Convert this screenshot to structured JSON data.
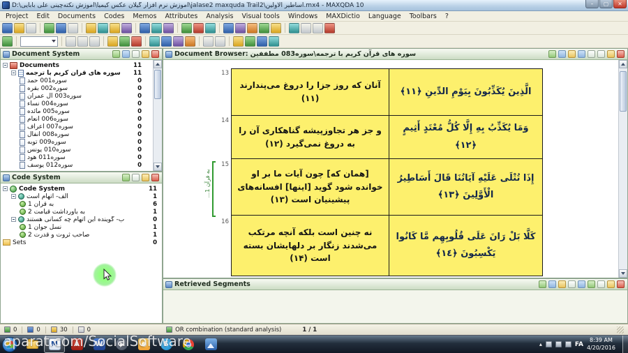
{
  "window": {
    "title": "D:\\آموزش نرم افزار گیلان عکس کیمیا\\آموزش نکته‌چینی علی بابایی\\jalase2 maxquda Trail2\\اساطیر الاولین.mx4 - MAXQDA 10",
    "controls": {
      "minimize": "–",
      "maximize": "▢",
      "close": "✕"
    }
  },
  "menu": {
    "items": [
      "Project",
      "Edit",
      "Documents",
      "Codes",
      "Memos",
      "Attributes",
      "Analysis",
      "Visual tools",
      "Windows",
      "MAXDictio",
      "Language",
      "Toolbars",
      "?"
    ]
  },
  "toolbar_main": {
    "icons": [
      "new-project",
      "open-project",
      "save-project",
      "new-document-group",
      "import-document",
      "print-document",
      "memo-manager",
      "overview-coded-segments",
      "overview-memos",
      "overview-links",
      "text-search",
      "lexical-search",
      "complex-search",
      "activate-documents",
      "reset-activation",
      "retrieved-segments",
      "maxmaps",
      "visual-tools",
      "document-portrait",
      "codeline",
      "word-cloud",
      "statistics",
      "undo",
      "redo",
      "help"
    ]
  },
  "toolbar_code": {
    "icons": [
      "edit-mode",
      "font-combo",
      "bold",
      "italic",
      "underline",
      "highlight-yellow",
      "highlight-green",
      "highlight-magenta",
      "code-selection",
      "code-new",
      "code-in-vivo",
      "emoticode",
      "zoom-out",
      "zoom-in",
      "bookmark",
      "coding-stripes",
      "search-in-document",
      "display-settings"
    ],
    "combo_value": ""
  },
  "document_system": {
    "title": "Document System",
    "header_icons": [
      "activate-icon",
      "new-group-icon",
      "float-icon",
      "maximize-icon",
      "close-icon"
    ],
    "root": {
      "label": "Documents",
      "count": "11"
    },
    "group": {
      "label": "سوره های قرآن کریم با ترجمه",
      "count": "11"
    },
    "items": [
      {
        "label": "سوره001 حمد",
        "count": "0"
      },
      {
        "label": "سوره002 بقره",
        "count": "0"
      },
      {
        "label": "سوره003 آل عمران",
        "count": "0"
      },
      {
        "label": "سوره004 نساء",
        "count": "0"
      },
      {
        "label": "سوره005 مائده",
        "count": "0"
      },
      {
        "label": "سوره006 انعام",
        "count": "0"
      },
      {
        "label": "سوره007 اعراف",
        "count": "0"
      },
      {
        "label": "سوره008 انفال",
        "count": "0"
      },
      {
        "label": "سوره009 توبه",
        "count": "0"
      },
      {
        "label": "سوره010 یونس",
        "count": "0"
      },
      {
        "label": "سوره011 هود",
        "count": "0"
      },
      {
        "label": "سوره012 یوسف",
        "count": "0"
      }
    ]
  },
  "code_system": {
    "title": "Code System",
    "header_icons": [
      "new-code-icon",
      "float-icon",
      "maximize-icon",
      "close-icon"
    ],
    "root": {
      "label": "Code System",
      "count": "11"
    },
    "items": [
      {
        "label": "الف- اتهام است",
        "count": "1"
      },
      {
        "label": "به قرآن 1",
        "count": "6"
      },
      {
        "label": "به باورداشت قیامت 2",
        "count": "1"
      },
      {
        "label": "ب- گوینده این اتهام چه کسانی هستند",
        "count": "0"
      },
      {
        "label": "نسل جوان 1",
        "count": "1"
      },
      {
        "label": "صاحب ثروت و قدرت 2",
        "count": "1"
      },
      {
        "label": "Sets",
        "count": "0"
      }
    ]
  },
  "document_browser": {
    "label": "Document Browser:",
    "doc_title": "سوره های قرآن کریم با ترجمه\\سوره083 مطففین",
    "header_icons": [
      "edit-mode-icon",
      "coding-stripes-icon",
      "bookmark-icon",
      "search-icon",
      "print-icon",
      "float-icon",
      "maximize-icon",
      "close-icon"
    ],
    "coding_stripe_label": "به قرآن 1...",
    "rows": [
      {
        "num": "13",
        "persian": "آنان که روز جزا را دروغ می‌پندارند (۱۱)",
        "arabic": "الَّذِينَ يُكَذِّبُونَ بِيَوْمِ الدِّينِ ﴿١١﴾"
      },
      {
        "num": "14",
        "persian": "و جز هر تجاوزپیشه گناهکاری آن را به دروغ نمی‌گیرد (۱۲)",
        "arabic": "وَمَا يُكَذِّبُ بِهِ إِلَّا كُلُّ مُعْتَدٍ أَثِيمٍ ﴿١٢﴾"
      },
      {
        "num": "15",
        "persian": "[همان که] چون آیات ما بر او خوانده شود گوید [اینها] افسانه‌های پیشینیان است (۱۳)",
        "arabic": "إِذَا تُتْلَى عَلَيْهِ آيَاتُنَا قَالَ أَسَاطِيرُ الْأَوَّلِينَ ﴿١٣﴾"
      },
      {
        "num": "16",
        "persian": "نه چنین است بلکه آنچه مرتکب می‌شدند زنگار بر دلهایشان بسته است (۱۴)",
        "arabic": "كَلَّا بَلْ رَانَ عَلَى قُلُوبِهِم مَّا كَانُوا يَكْسِبُونَ ﴿١٤﴾"
      }
    ]
  },
  "retrieved_segments": {
    "title": "Retrieved Segments",
    "header_icons": [
      "filter-icon",
      "overview-icon",
      "export-icon",
      "print-icon",
      "word-icon",
      "dock-icon",
      "float-icon",
      "maximize-icon",
      "close-icon"
    ]
  },
  "status_bar": {
    "counts": [
      "0",
      "0",
      "30",
      "0"
    ],
    "count_icons": [
      "documents-status-icon",
      "codes-status-icon",
      "segments-status-icon",
      "memos-status-icon"
    ],
    "combination_label": "OR combination (standard analysis)",
    "position": "1 / 1"
  },
  "taskbar": {
    "apps": [
      {
        "name": "windows-explorer",
        "glyph": ""
      },
      {
        "name": "maxqda",
        "glyph": "M"
      },
      {
        "name": "adobe-reader",
        "glyph": "A"
      },
      {
        "name": "word",
        "glyph": "W"
      },
      {
        "name": "media-player",
        "glyph": ""
      },
      {
        "name": "photo-viewer",
        "glyph": ""
      },
      {
        "name": "skype",
        "glyph": "S"
      },
      {
        "name": "chrome",
        "glyph": ""
      },
      {
        "name": "image-editor",
        "glyph": ""
      }
    ],
    "tray": {
      "hidden_icons": "▴",
      "language": "FA",
      "time": "8:39 AM",
      "date": "4/20/2016"
    }
  },
  "watermark": "aparat.com/SocialSoftware"
}
